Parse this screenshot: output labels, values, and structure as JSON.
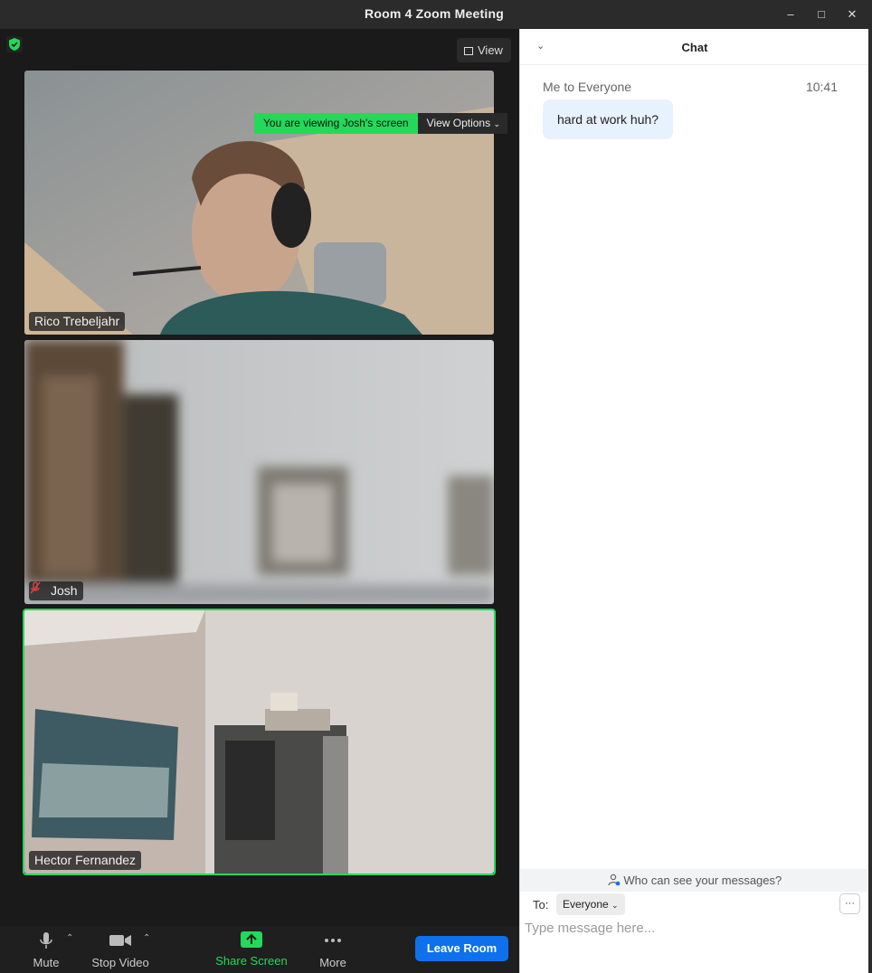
{
  "window": {
    "title": "Room 4  Zoom Meeting",
    "minimize_glyph": "–",
    "maximize_glyph": "□",
    "close_glyph": "✕"
  },
  "meeting": {
    "view_button": "View",
    "banner_text": "You are viewing Josh's screen",
    "view_options": "View Options",
    "participants": [
      {
        "name": "Rico Trebeljahr",
        "muted": false
      },
      {
        "name": "Josh",
        "muted": true
      },
      {
        "name": "Hector Fernandez",
        "muted": false,
        "active_speaker": true
      }
    ]
  },
  "toolbar": {
    "mute": "Mute",
    "stop_video": "Stop Video",
    "share_screen": "Share Screen",
    "more": "More",
    "leave": "Leave Room"
  },
  "chat": {
    "header": "Chat",
    "messages": [
      {
        "sender": "Me to Everyone",
        "time": "10:41",
        "text": "hard at work huh?"
      }
    ],
    "who_can_see": "Who can see your messages?",
    "to_label": "To:",
    "recipient": "Everyone",
    "more_glyph": "···",
    "input_placeholder": "Type message here..."
  },
  "colors": {
    "accent_green": "#23d959",
    "leave_blue": "#0e71eb",
    "bubble_bg": "#e8f1fe"
  }
}
